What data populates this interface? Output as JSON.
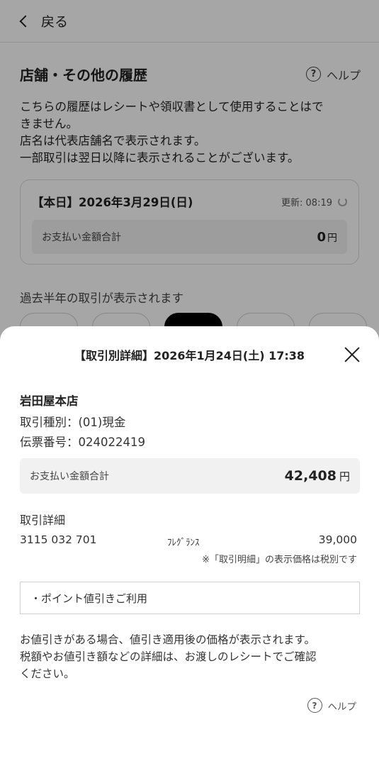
{
  "header": {
    "back_label": "戻る"
  },
  "history": {
    "title": "店舗・その他の履歴",
    "help_label": "ヘルプ",
    "notice_lines": [
      "こちらの履歴はレシートや領収書として使用することはで",
      "きません。",
      "店名は代表店舗名で表示されます。",
      "一部取引は翌日以降に表示されることがございます。"
    ],
    "today": {
      "date": "【本日】2026年3月29日(日)",
      "updated": "更新: 08:19",
      "total_label": "お支払い金額合計",
      "total_value": "0",
      "currency": "円"
    },
    "past_note": "過去半年の取引が表示されます"
  },
  "sheet": {
    "title": "【取引別詳細】2026年1月24日(土) 17:38",
    "store": "岩田屋本店",
    "type": "取引種別：(01)現金",
    "slip": "伝票番号：024022419",
    "total_label": "お支払い金額合計",
    "total_value": "42,408",
    "currency": "円",
    "detail_label": "取引詳細",
    "item": {
      "code": "3115 032 701",
      "name": "ﾌﾚｸﾞﾗﾝｽ",
      "price": "39,000"
    },
    "tax_note": "※「取引明細」の表示価格は税別です",
    "point_label": "・ポイント値引きご利用",
    "discount_lines": [
      "お値引きがある場合、値引き適用後の価格が表示されます。",
      "税額やお値引き額などの詳細は、お渡しのレシートでご確認",
      "ください。"
    ],
    "help_label": "ヘルプ"
  },
  "icons": {
    "back": "chevron-left-icon",
    "help": "question-circle-icon",
    "refresh": "refresh-icon",
    "close": "close-icon"
  }
}
